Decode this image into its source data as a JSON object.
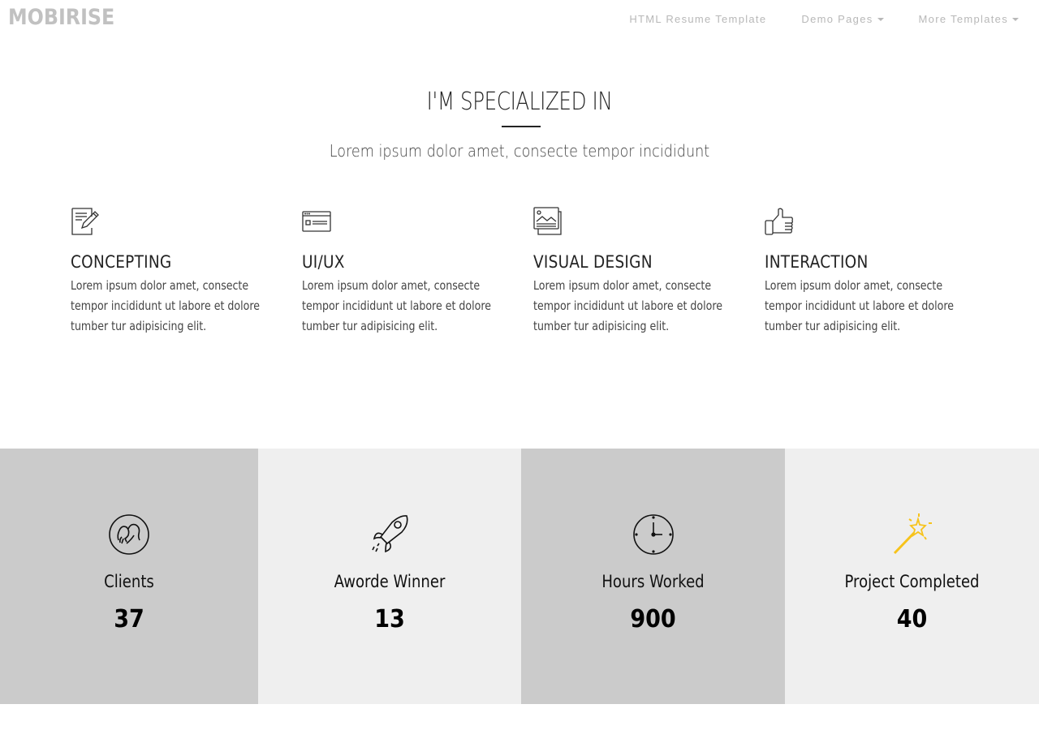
{
  "navbar": {
    "brand": "MOBIRISE",
    "links": [
      {
        "label": "HTML Resume Template",
        "has_dropdown": false
      },
      {
        "label": "Demo Pages",
        "has_dropdown": true
      },
      {
        "label": "More Templates",
        "has_dropdown": true
      }
    ]
  },
  "section": {
    "title": "I'M SPECIALIZED IN",
    "subtitle": "Lorem ipsum dolor amet, consecte tempor incididunt"
  },
  "features": [
    {
      "icon": "edit-document-icon",
      "title": "CONCEPTING",
      "text": "Lorem ipsum dolor amet, consecte tempor incididunt ut labore et dolore tumber tur adipisicing elit."
    },
    {
      "icon": "browser-window-icon",
      "title": "UI/UX",
      "text": "Lorem ipsum dolor amet, consecte tempor incididunt ut labore et dolore tumber tur adipisicing elit."
    },
    {
      "icon": "image-gallery-icon",
      "title": "VISUAL DESIGN",
      "text": "Lorem ipsum dolor amet, consecte tempor incididunt ut labore et dolore tumber tur adipisicing elit."
    },
    {
      "icon": "thumbs-up-icon",
      "title": "INTERACTION",
      "text": "Lorem ipsum dolor amet, consecte tempor incididunt ut labore et dolore tumber tur adipisicing elit."
    }
  ],
  "counters": [
    {
      "icon": "users-icon",
      "label": "Clients",
      "value": "37"
    },
    {
      "icon": "rocket-icon",
      "label": "Aworde Winner",
      "value": "13"
    },
    {
      "icon": "clock-icon",
      "label": "Hours Worked",
      "value": "900"
    },
    {
      "icon": "magic-wand-icon",
      "label": "Project Completed",
      "value": "40"
    }
  ],
  "colors": {
    "brand": "#c1c1c1",
    "nav_link": "#b8b8b8",
    "heading": "#232323",
    "counter_dark_bg": "#cbcbcb",
    "counter_light_bg": "#efefef",
    "wand_accent": "#f7c31b"
  }
}
